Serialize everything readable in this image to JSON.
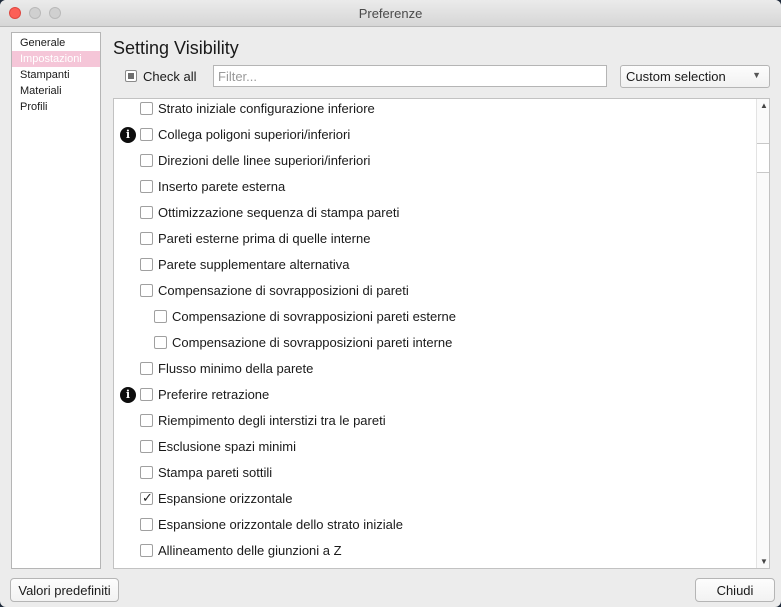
{
  "window": {
    "title": "Preferenze"
  },
  "sidebar": {
    "items": [
      {
        "label": "Generale",
        "selected": false
      },
      {
        "label": "Impostazioni",
        "selected": true
      },
      {
        "label": "Stampanti",
        "selected": false
      },
      {
        "label": "Materiali",
        "selected": false
      },
      {
        "label": "Profili",
        "selected": false
      }
    ]
  },
  "main": {
    "heading": "Setting Visibility",
    "check_all_label": "Check all",
    "filter_placeholder": "Filter...",
    "filter_value": "",
    "selection_label": "Custom selection",
    "settings": [
      {
        "label": "Strato iniziale configurazione inferiore",
        "checked": false,
        "indent": 0,
        "info": false
      },
      {
        "label": "Collega poligoni superiori/inferiori",
        "checked": false,
        "indent": 0,
        "info": true
      },
      {
        "label": "Direzioni delle linee superiori/inferiori",
        "checked": false,
        "indent": 0,
        "info": false
      },
      {
        "label": "Inserto parete esterna",
        "checked": false,
        "indent": 0,
        "info": false
      },
      {
        "label": "Ottimizzazione sequenza di stampa pareti",
        "checked": false,
        "indent": 0,
        "info": false
      },
      {
        "label": "Pareti esterne prima di quelle interne",
        "checked": false,
        "indent": 0,
        "info": false
      },
      {
        "label": "Parete supplementare alternativa",
        "checked": false,
        "indent": 0,
        "info": false
      },
      {
        "label": "Compensazione di sovrapposizioni di pareti",
        "checked": false,
        "indent": 0,
        "info": false
      },
      {
        "label": "Compensazione di sovrapposizioni pareti esterne",
        "checked": false,
        "indent": 1,
        "info": false
      },
      {
        "label": "Compensazione di sovrapposizioni pareti interne",
        "checked": false,
        "indent": 1,
        "info": false
      },
      {
        "label": "Flusso minimo della parete",
        "checked": false,
        "indent": 0,
        "info": false
      },
      {
        "label": "Preferire retrazione",
        "checked": false,
        "indent": 0,
        "info": true
      },
      {
        "label": "Riempimento degli interstizi tra le pareti",
        "checked": false,
        "indent": 0,
        "info": false
      },
      {
        "label": "Esclusione spazi minimi",
        "checked": false,
        "indent": 0,
        "info": false
      },
      {
        "label": "Stampa pareti sottili",
        "checked": false,
        "indent": 0,
        "info": false
      },
      {
        "label": "Espansione orizzontale",
        "checked": true,
        "indent": 0,
        "info": false
      },
      {
        "label": "Espansione orizzontale dello strato iniziale",
        "checked": false,
        "indent": 0,
        "info": false
      },
      {
        "label": "Allineamento delle giunzioni a Z",
        "checked": false,
        "indent": 0,
        "info": false
      }
    ]
  },
  "buttons": {
    "defaults": "Valori predefiniti",
    "close": "Chiudi"
  },
  "colors": {
    "selection": "#f5c6d8",
    "close_light": "#fc5f57"
  },
  "icons": {
    "info": "info-icon",
    "check": "✓",
    "arrow_up": "▲",
    "arrow_down": "▼"
  }
}
